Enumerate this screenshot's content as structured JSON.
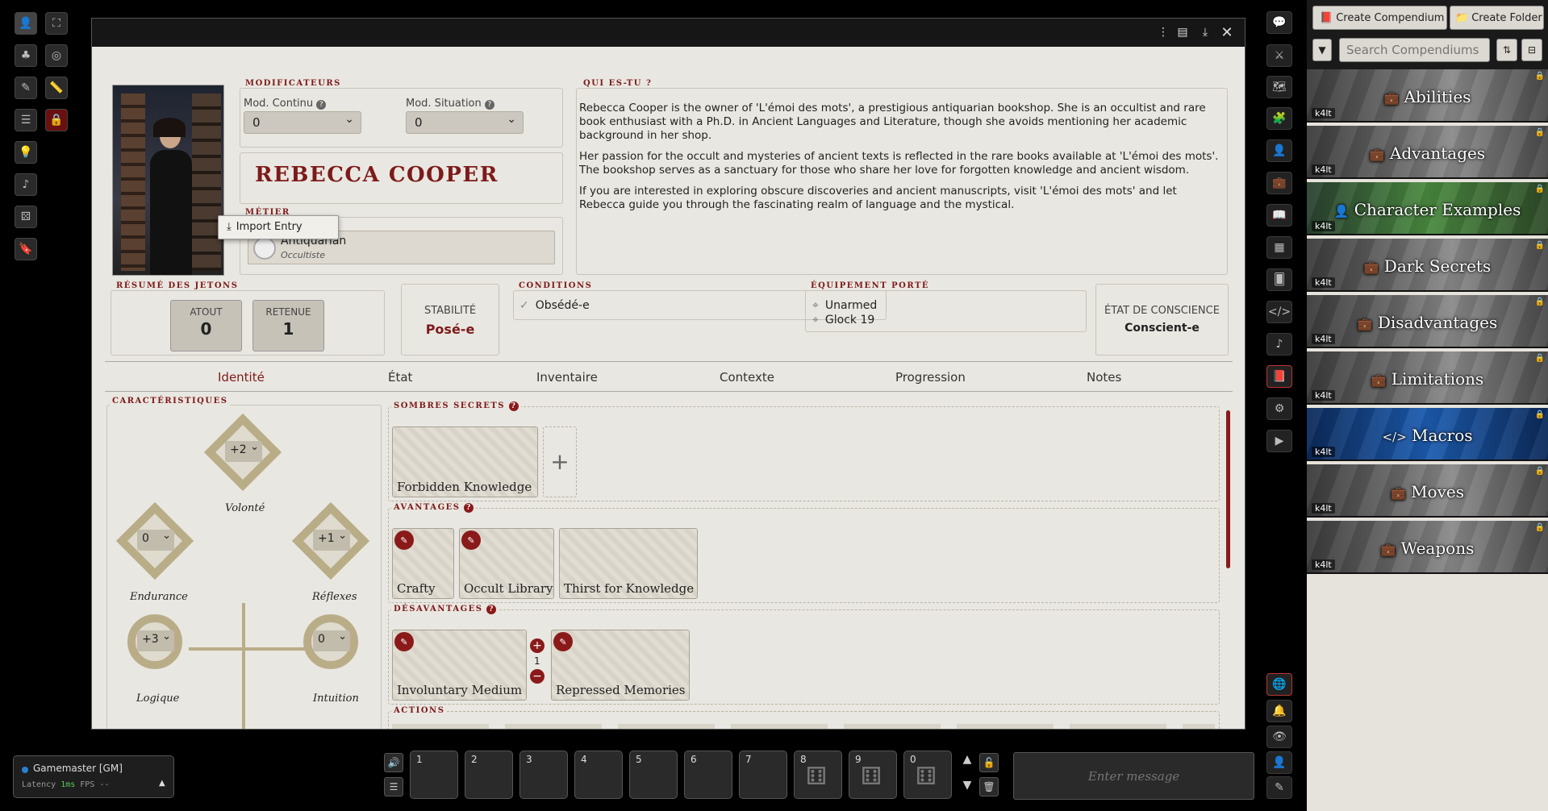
{
  "sheet": {
    "legends": {
      "modifiers": "Modificateurs",
      "who": "Qui es-tu ?",
      "job": "Métier",
      "tokens": "Résumé des jetons",
      "conditions": "Conditions",
      "equipment": "Équipement porté",
      "characteristics": "Caractéristiques",
      "dark_secrets": "Sombres secrets",
      "advantages": "Avantages",
      "disadvantages": "Désavantages",
      "actions": "Actions"
    },
    "mod_continu_label": "Mod. Continu",
    "mod_continu_value": "0",
    "mod_situation_label": "Mod. Situation",
    "mod_situation_value": "0",
    "name": "Rebecca Cooper",
    "job_name": "Antiquarian",
    "job_sub": "Occultiste",
    "context_menu_item": "Import Entry",
    "bio": [
      "Rebecca Cooper is the owner of 'L'émoi des mots', a prestigious antiquarian bookshop. She is an occultist and rare book enthusiast with a Ph.D. in Ancient Languages and Literature, though she avoids mentioning her academic background in her shop.",
      "Her passion for the occult and mysteries of ancient texts is reflected in the rare books available at 'L'émoi des mots'. The bookshop serves as a sanctuary for those who share her love for forgotten knowledge and ancient wisdom.",
      "If you are interested in exploring obscure discoveries and ancient manuscripts, visit 'L'émoi des mots' and let Rebecca guide you through the fascinating realm of language and the mystical."
    ],
    "tokens": {
      "atout_label": "ATOUT",
      "atout_value": "0",
      "retenue_label": "RETENUE",
      "retenue_value": "1"
    },
    "stability_label": "STABILITÉ",
    "stability_value": "Posé-e",
    "condition": "Obsédé-e",
    "equipment": [
      "Unarmed",
      "Glock 19"
    ],
    "consciousness_label": "ÉTAT DE CONSCIENCE",
    "consciousness_value": "Conscient-e",
    "tabs": [
      "Identité",
      "État",
      "Inventaire",
      "Contexte",
      "Progression",
      "Notes"
    ],
    "attributes": {
      "volonte": {
        "label": "Volonté",
        "value": "+2"
      },
      "endurance": {
        "label": "Endurance",
        "value": "0"
      },
      "reflexes": {
        "label": "Réflexes",
        "value": "+1"
      },
      "logique": {
        "label": "Logique",
        "value": "+3"
      },
      "intuition": {
        "label": "Intuition",
        "value": "0"
      }
    },
    "dark_secrets": [
      "Forbidden Knowledge"
    ],
    "advantages": [
      "Crafty",
      "Occult Library",
      "Thirst for Knowledge"
    ],
    "disadvantages": [
      "Involuntary Medium",
      "Repressed Memories"
    ],
    "disadvantage_counter": "1"
  },
  "sidebar": {
    "create_compendium": "Create Compendium",
    "create_folder": "Create Folder",
    "search_placeholder": "Search Compendiums",
    "system_tag": "k4lt",
    "compendiums": [
      "Abilities",
      "Advantages",
      "Character Examples",
      "Dark Secrets",
      "Disadvantages",
      "Limitations",
      "Macros",
      "Moves",
      "Weapons"
    ]
  },
  "players": {
    "user": "Gamemaster [GM]",
    "latency_label": "Latency",
    "latency_value": "1ms",
    "fps_label": "FPS",
    "fps_value": "--"
  },
  "hotbar": {
    "slots": [
      "1",
      "2",
      "3",
      "4",
      "5",
      "6",
      "7",
      "8",
      "9",
      "0"
    ]
  },
  "chat": {
    "placeholder": "Enter message"
  }
}
